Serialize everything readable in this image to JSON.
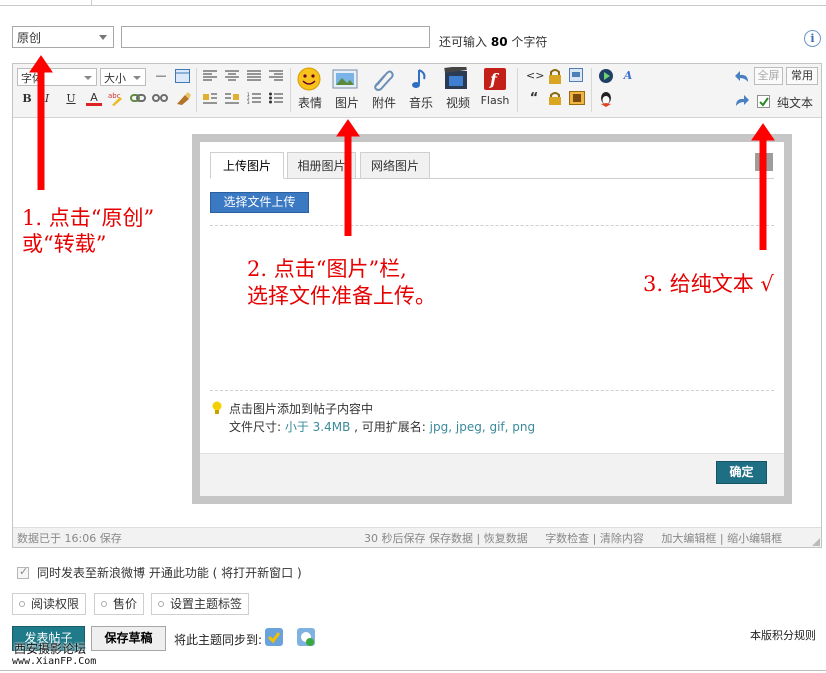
{
  "title_row": {
    "type_select_value": "原创",
    "char_hint_prefix": "还可输入",
    "char_hint_count": "80",
    "char_hint_suffix": "个字符",
    "info_icon_glyph": "i"
  },
  "toolbar": {
    "font_select": "字体",
    "size_select": "大小",
    "format_buttons": [
      "B",
      "I",
      "U",
      "A"
    ],
    "media": {
      "emoticon_label": "表情",
      "image_label": "图片",
      "attachment_label": "附件",
      "music_label": "音乐",
      "video_label": "视频",
      "flash_label": "Flash"
    },
    "fullscreen_label": "全屏",
    "common_label": "常用",
    "plaintext_label": "纯文本",
    "plaintext_checked": true
  },
  "statusbar": {
    "saved_text": "数据已于 16:06 保存",
    "autosave_text": "30 秒后保存",
    "save_data": "保存数据",
    "restore_data": "恢复数据",
    "word_check": "字数检查",
    "clear_content": "清除内容",
    "enlarge_editor": "加大编辑框",
    "shrink_editor": "缩小编辑框"
  },
  "dialog": {
    "tabs": [
      "上传图片",
      "相册图片",
      "网络图片"
    ],
    "active_tab": 0,
    "upload_button": "选择文件上传",
    "tip_line1": "点击图片添加到帖子内容中",
    "tip_size_label": "文件尺寸: ",
    "tip_size_value": "小于 3.4MB",
    "tip_ext_label": " , 可用扩展名: ",
    "tip_ext_value": "jpg, jpeg, gif, png",
    "ok_button": "确定"
  },
  "annotations": {
    "step1_line1": "1. 点击“原创”",
    "step1_line2": "或“转载”",
    "step2_line1": "2. 点击“图片”栏,",
    "step2_line2": "选择文件准备上传。",
    "step3": "3. 给纯文本 √",
    "color": "#e60000"
  },
  "bottom": {
    "weibo_text": "同时发表至新浪微博 开通此功能 ( 将打开新窗口 )",
    "options": [
      "阅读权限",
      "售价",
      "设置主题标签"
    ],
    "post_button": "发表帖子",
    "draft_button": "保存草稿",
    "sync_label": "将此主题同步到:",
    "rules_link": "本版积分规则",
    "watermark_line1": "西安摄影论坛",
    "watermark_line2": "www.XianFP.Com"
  },
  "colors": {
    "accent_blue": "#3b79c3",
    "teal_button": "#1f7a8a",
    "annotation_red": "#e60000"
  }
}
